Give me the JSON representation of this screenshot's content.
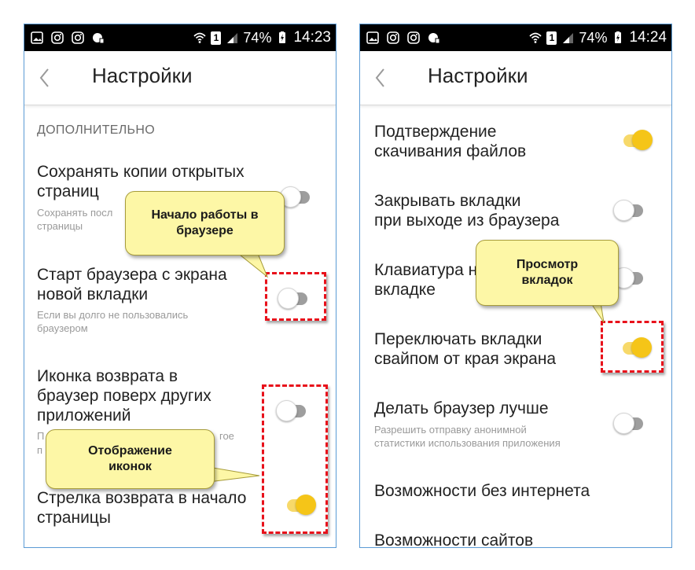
{
  "left_screen": {
    "status": {
      "battery": "74%",
      "time": "14:23",
      "sim": "1"
    },
    "title": "Настройки",
    "section": "ДОПОЛНИТЕЛЬНО",
    "items": [
      {
        "title_1": "Сохранять копии открытых",
        "title_2": "страниц",
        "sub_1": "Сохранять посл",
        "sub_2": "страницы",
        "toggle": "off"
      },
      {
        "title_1": "Старт браузера с экрана",
        "title_2": "новой вкладки",
        "sub_1": "Если вы долго не пользовались",
        "sub_2": "браузером",
        "toggle": "off"
      },
      {
        "title_1": "Иконка возврата в",
        "title_2": "браузер поверх других",
        "title_3": "приложений",
        "sub_1": "П",
        "sub_1b": "гое",
        "sub_2": "п",
        "toggle": "off"
      },
      {
        "title_1": "Стрелка возврата в начало",
        "title_2": "страницы",
        "toggle": "on"
      }
    ]
  },
  "right_screen": {
    "status": {
      "battery": "74%",
      "time": "14:24",
      "sim": "1"
    },
    "title": "Настройки",
    "items": [
      {
        "title_1": "Подтверждение",
        "title_2": "скачивания файлов",
        "toggle": "on"
      },
      {
        "title_1": "Закрывать вкладки",
        "title_2": "при выходе из браузера",
        "toggle": "off"
      },
      {
        "title_1": "Клавиатура н",
        "title_2": "вкладке",
        "toggle": "off"
      },
      {
        "title_1": "Переключать вкладки",
        "title_2": "свайпом от края экрана",
        "toggle": "on"
      },
      {
        "title_1": "Делать браузер лучше",
        "sub_1": "Разрешить отправку анонимной",
        "sub_2": "статистики использования приложения",
        "toggle": "off"
      },
      {
        "title_1": "Возможности без интернета"
      },
      {
        "title_1": "Возможности сайтов"
      }
    ]
  },
  "callouts": {
    "start_browser": {
      "line1": "Начало работы в",
      "line2": "браузере"
    },
    "icons_display": {
      "line1": "Отображение",
      "line2": "иконок"
    },
    "tabs_view": {
      "line1": "Просмотр",
      "line2": "вкладок"
    }
  },
  "colors": {
    "toggle_on": "#f5c518",
    "toggle_off": "#9e9e9e",
    "highlight_border": "#e8111b",
    "callout_fill": "#fdf7a6",
    "frame_border": "#5b9bd5"
  }
}
